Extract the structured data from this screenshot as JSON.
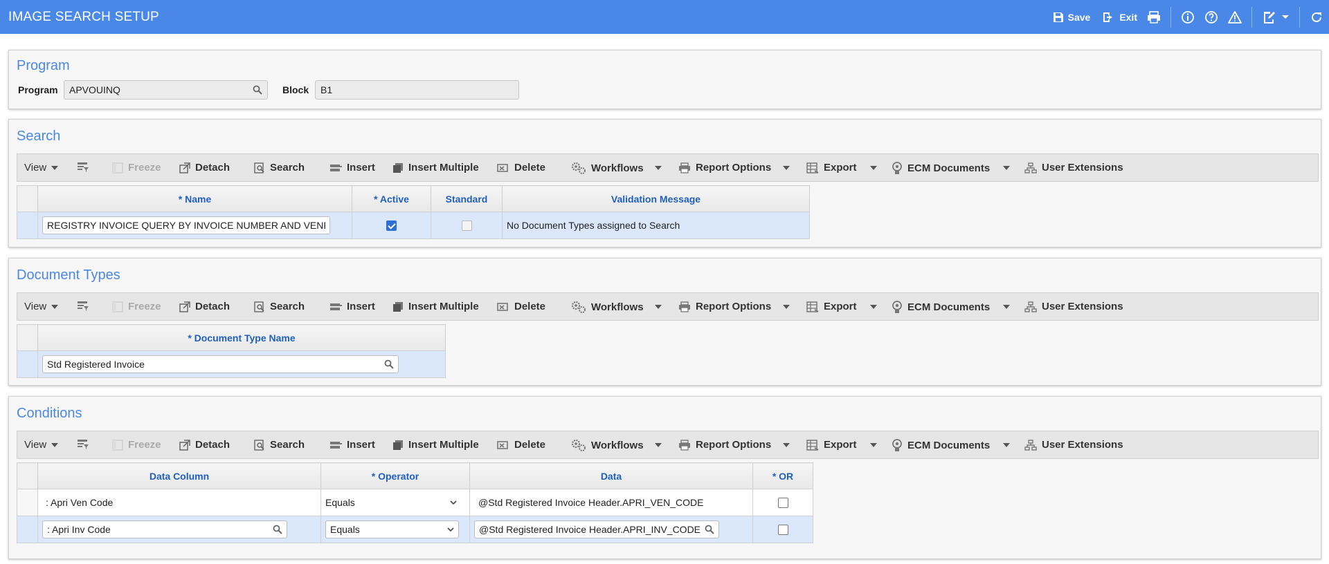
{
  "app": {
    "title": "IMAGE SEARCH SETUP"
  },
  "topbar": {
    "save_label": "Save",
    "exit_label": "Exit",
    "icons": [
      "save-icon",
      "exit-icon",
      "print-icon",
      "info-icon",
      "help-icon",
      "warning-icon",
      "edit-icon",
      "chevron-down-icon",
      "refresh-icon"
    ]
  },
  "program_panel": {
    "title": "Program",
    "program_label": "Program",
    "program_value": "APVOUINQ",
    "block_label": "Block",
    "block_value": "B1"
  },
  "toolbar": {
    "view": "View",
    "freeze": "Freeze",
    "detach": "Detach",
    "search": "Search",
    "insert": "Insert",
    "insert_multiple": "Insert Multiple",
    "delete": "Delete",
    "workflows": "Workflows",
    "report_options": "Report Options",
    "export": "Export",
    "ecm_documents": "ECM Documents",
    "user_extensions": "User Extensions"
  },
  "search_panel": {
    "title": "Search",
    "columns": [
      "* Name",
      "* Active",
      "Standard",
      "Validation Message"
    ],
    "rows": [
      {
        "name": "REGISTRY INVOICE QUERY BY INVOICE NUMBER AND VENDOR",
        "active": true,
        "standard": false,
        "validation_message": "No Document Types assigned to Search"
      }
    ]
  },
  "doctypes_panel": {
    "title": "Document Types",
    "columns": [
      "* Document Type Name"
    ],
    "rows": [
      {
        "document_type_name": "Std Registered Invoice"
      }
    ]
  },
  "conditions_panel": {
    "title": "Conditions",
    "columns": [
      "Data Column",
      "* Operator",
      "Data",
      "* OR"
    ],
    "rows": [
      {
        "data_column": ": Apri Ven Code",
        "operator": "Equals",
        "data": "@Std Registered Invoice Header.APRI_VEN_CODE",
        "or": false
      },
      {
        "data_column": ": Apri Inv Code",
        "operator": "Equals",
        "data": "@Std Registered Invoice Header.APRI_INV_CODE",
        "or": false
      }
    ]
  },
  "colors": {
    "accent": "#4a88e8",
    "header_text": "#1f5fbf",
    "selected_row": "#dbe7fb"
  }
}
